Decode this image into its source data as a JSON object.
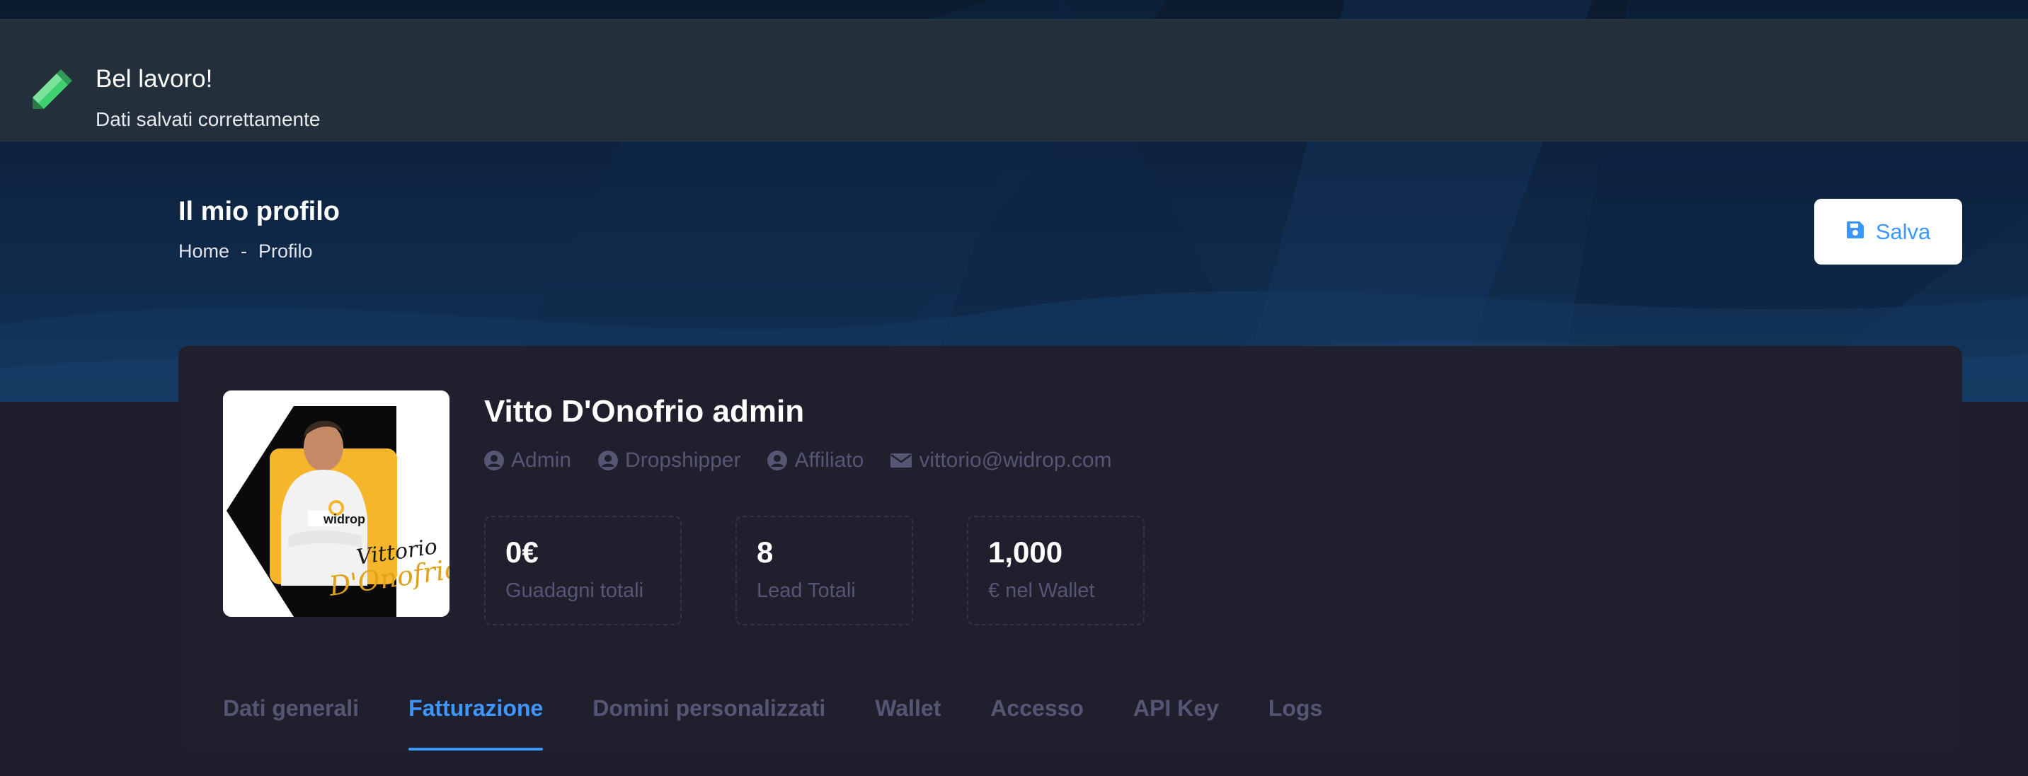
{
  "notification": {
    "title": "Bel lavoro!",
    "message": "Dati salvati correttamente",
    "icon": "pencil-icon",
    "accent": "#3ecf6e"
  },
  "toolbar": {
    "page_title": "Il mio profilo",
    "breadcrumb": [
      "Home",
      "-",
      "Profilo"
    ],
    "save_label": "Salva",
    "save_icon": "floppy-disk-icon"
  },
  "profile": {
    "name": "Vitto D'Onofrio admin",
    "avatar_signature": "Vittorio D'Onofrio",
    "avatar_brand": "widrop",
    "roles": [
      {
        "label": "Admin",
        "icon": "user-circle-icon"
      },
      {
        "label": "Dropshipper",
        "icon": "user-circle-icon"
      },
      {
        "label": "Affiliato",
        "icon": "user-circle-icon"
      },
      {
        "label": "vittorio@widrop.com",
        "icon": "envelope-icon"
      }
    ],
    "stats": [
      {
        "value": "0€",
        "label": "Guadagni totali"
      },
      {
        "value": "8",
        "label": "Lead Totali"
      },
      {
        "value": "1,000",
        "label": "€ nel Wallet"
      }
    ]
  },
  "tabs": [
    {
      "label": "Dati generali",
      "active": false
    },
    {
      "label": "Fatturazione",
      "active": true
    },
    {
      "label": "Domini personalizzati",
      "active": false
    },
    {
      "label": "Wallet",
      "active": false
    },
    {
      "label": "Accesso",
      "active": false
    },
    {
      "label": "API Key",
      "active": false
    },
    {
      "label": "Logs",
      "active": false
    }
  ],
  "colors": {
    "primary": "#3e97ff",
    "card_bg": "#201f2e",
    "muted": "#565674",
    "page_bg": "#1e1e2d"
  }
}
